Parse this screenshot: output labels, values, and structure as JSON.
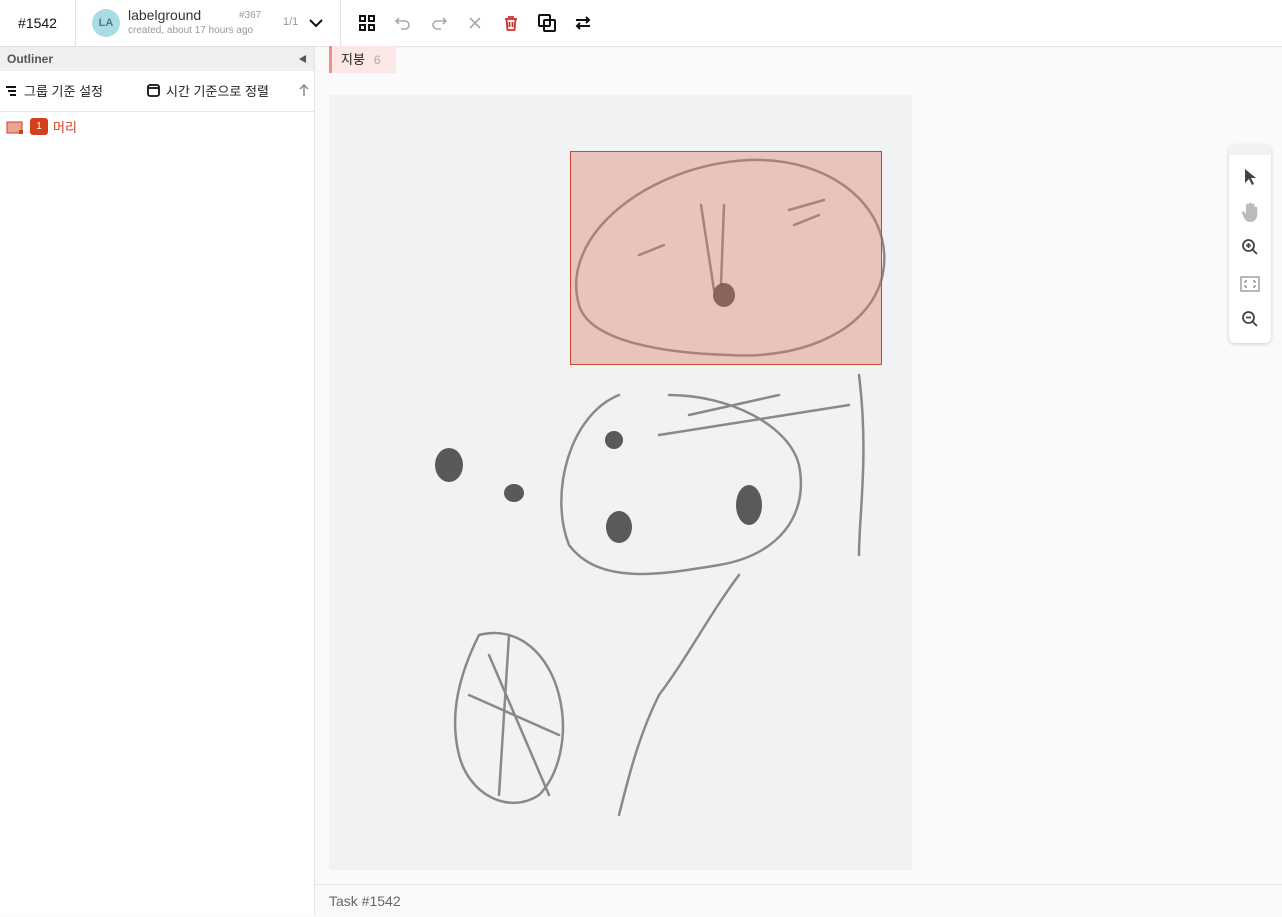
{
  "header": {
    "task_id": "#1542",
    "annotation": {
      "avatar_initials": "LA",
      "user": "labelground",
      "created": "created, about 17 hours ago",
      "id": "#367",
      "count": "1/1"
    },
    "toolbar_icons": [
      "grid-icon",
      "undo-icon",
      "redo-icon",
      "close-icon",
      "delete-icon",
      "copy-icon",
      "swap-icon"
    ],
    "delete_color": "#d32f2f"
  },
  "sidebar": {
    "title": "Outliner",
    "group_label": "그룹 기준 설정",
    "sort_label": "시간 기준으로 정렬",
    "items": [
      {
        "badge": "1",
        "label": "머리",
        "color": "#d4401c"
      }
    ]
  },
  "canvas": {
    "label_chip": {
      "name": "지붕",
      "count": "6"
    },
    "bbox_color": "#c84a2c"
  },
  "tool_panel": [
    "pointer-icon",
    "hand-icon",
    "zoom-in-icon",
    "fit-screen-icon",
    "zoom-out-icon"
  ],
  "footer": {
    "text": "Task #1542"
  }
}
